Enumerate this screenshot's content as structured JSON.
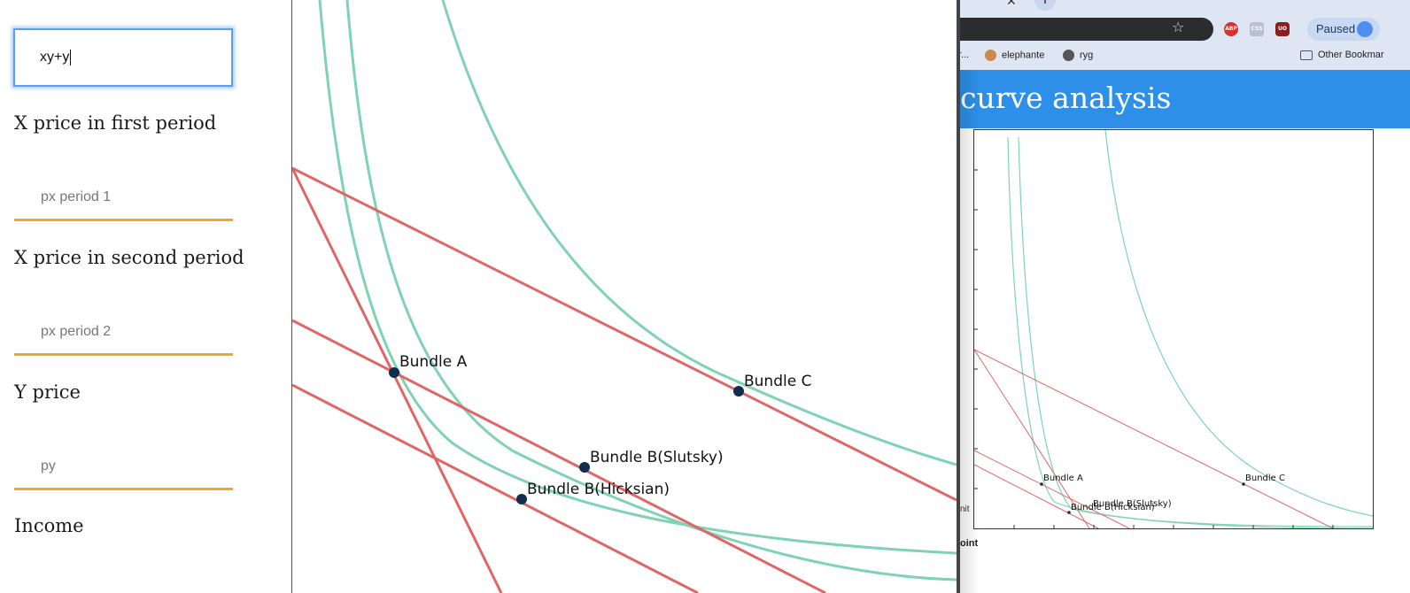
{
  "form": {
    "utility_value": "xy+y",
    "fields": [
      {
        "label": "X price in first period",
        "placeholder": "px period 1"
      },
      {
        "label": "X price in second period",
        "placeholder": "px period 2"
      },
      {
        "label": "Y price",
        "placeholder": "py"
      },
      {
        "label": "Income"
      }
    ]
  },
  "plot": {
    "bundles": [
      {
        "label": "Bundle A"
      },
      {
        "label": "Bundle C"
      },
      {
        "label": "Bundle B(Slutsky)"
      },
      {
        "label": "Bundle B(Hicksian)"
      }
    ],
    "colors": {
      "indifference": "#7fd3b3",
      "budget": "#e06666",
      "point": "#0f2d4f"
    }
  },
  "browser": {
    "tab_close_icon": "close-icon",
    "new_tab_label": "+",
    "paused_label": "Paused",
    "bookmarks": {
      "truncated": "r...",
      "item1": "elephante",
      "item2": "ryg",
      "other": "Other Bookmar"
    },
    "page_title": "curve analysis",
    "mini_bundles": [
      "Bundle A",
      "Bundle C",
      "Bundle B(Slutsky)",
      "Bundle B(Hicksian)"
    ],
    "snippet_1": "nit",
    "snippet_2": "oint"
  }
}
